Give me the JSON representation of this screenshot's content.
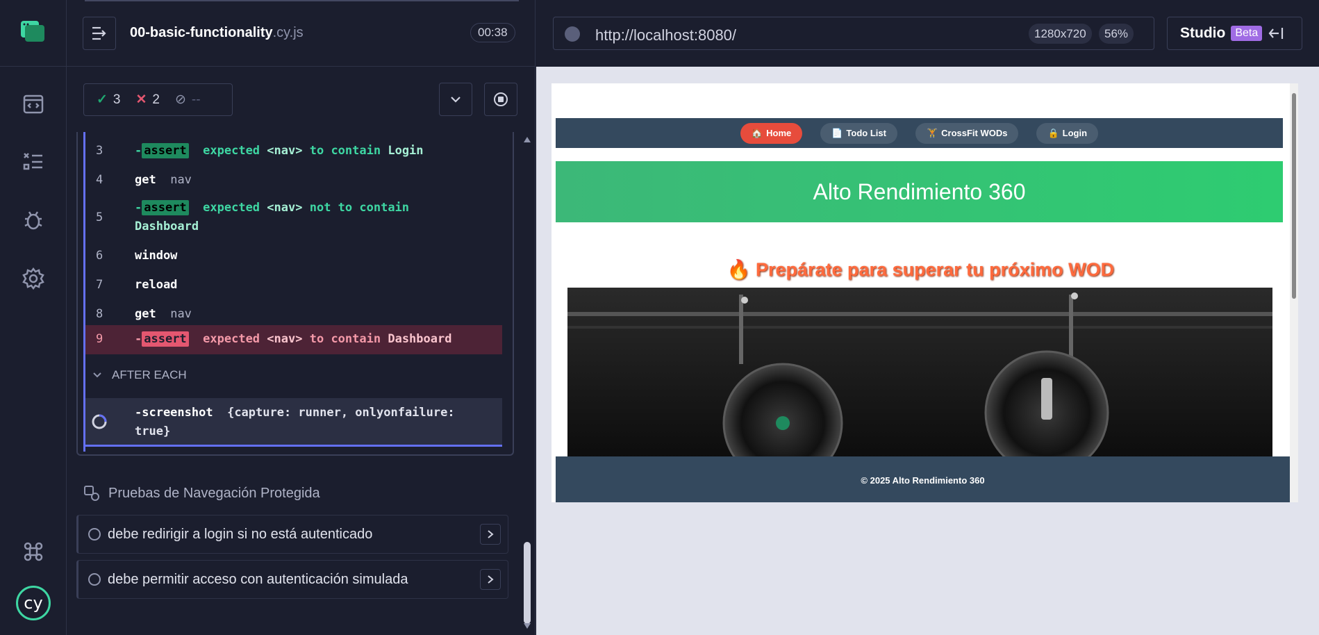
{
  "reporter": {
    "spec_name": "00-basic-functionality",
    "spec_ext": ".cy.js",
    "timer": "00:38",
    "stats": {
      "passed": "3",
      "failed": "2",
      "pending": "--"
    }
  },
  "commands": [
    {
      "num": "3",
      "name": "-",
      "tag": "assert",
      "text": [
        "expected",
        "<nav>",
        "to contain",
        "Login"
      ]
    },
    {
      "num": "4",
      "name": "get",
      "arg": "nav"
    },
    {
      "num": "5",
      "name": "-",
      "tag": "assert",
      "text": [
        "expected",
        "<nav>",
        "not to contain",
        "Dashboard"
      ]
    },
    {
      "num": "6",
      "name": "window"
    },
    {
      "num": "7",
      "name": "reload"
    },
    {
      "num": "8",
      "name": "get",
      "arg": "nav"
    },
    {
      "num": "9",
      "name": "-",
      "tag": "assert",
      "text": [
        "expected",
        "<nav>",
        "to contain",
        "Dashboard"
      ]
    }
  ],
  "after_each": {
    "label": "AFTER EACH",
    "screenshot_name": "-screenshot",
    "screenshot_arg_1": "{capture: runner, onlyonfailure:",
    "screenshot_arg_2": "true}"
  },
  "suite": {
    "title": "Pruebas de Navegación Protegida",
    "tests": [
      "debe redirigir a login si no está autenticado",
      "debe permitir acceso con autenticación simulada"
    ]
  },
  "browser": {
    "url": "http://localhost:8080/",
    "viewport_size": "1280x720",
    "zoom": "56%",
    "studio_label": "Studio",
    "studio_badge": "Beta"
  },
  "site": {
    "nav": [
      {
        "icon": "🏠",
        "label": "Home"
      },
      {
        "icon": "📄",
        "label": "Todo List"
      },
      {
        "icon": "🏋",
        "label": "CrossFit WODs"
      },
      {
        "icon": "🔒",
        "label": "Login"
      }
    ],
    "hero_title": "Alto Rendimiento 360",
    "wod_title": "🔥 Prepárate para superar tu próximo WOD",
    "footer": "© 2025 Alto Rendimiento 360"
  },
  "colors": {
    "bg": "#1b1e2e",
    "pass": "#1fa971",
    "fail": "#e45770",
    "accent": "#6470f3",
    "site_nav": "#34495e",
    "site_hero": "#2ecc71",
    "site_active": "#e74c3c"
  }
}
